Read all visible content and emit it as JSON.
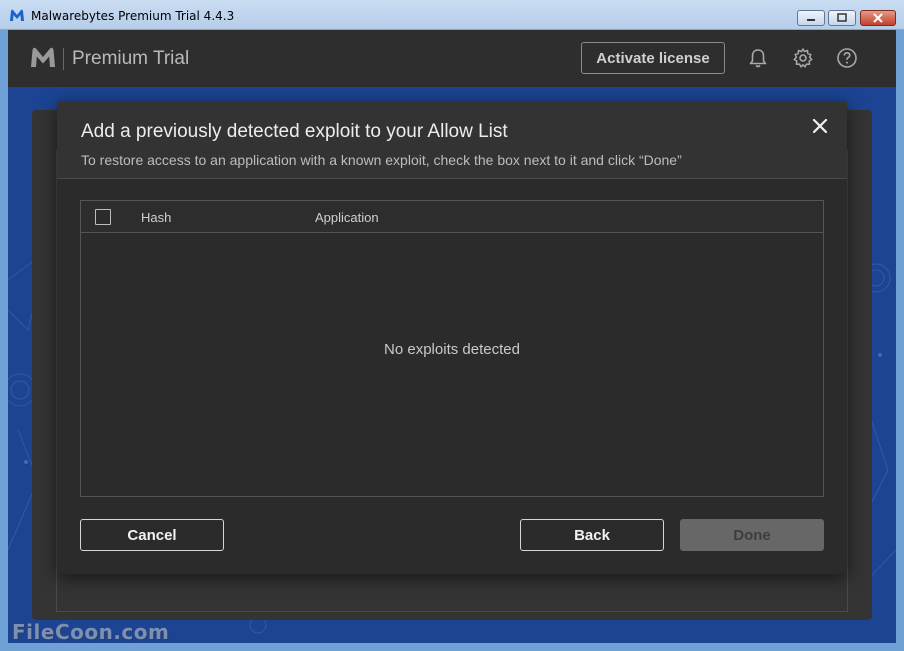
{
  "window": {
    "title": "Malwarebytes Premium Trial  4.4.3"
  },
  "header": {
    "brand": "Premium Trial",
    "activate_label": "Activate license",
    "icons": [
      "bell-icon",
      "gear-icon",
      "help-icon"
    ]
  },
  "dialog": {
    "title": "Add a previously detected exploit to your Allow List",
    "subtitle": "To restore access to an application with a known exploit, check the box next to it and click “Done”",
    "columns": [
      "Hash",
      "Application"
    ],
    "empty_message": "No exploits detected",
    "buttons": {
      "cancel": "Cancel",
      "back": "Back",
      "done": "Done"
    }
  },
  "watermark": "FileCoon.com",
  "colors": {
    "header_bg": "#2e2e2e",
    "dialog_bg": "#2b2b2b",
    "background_blue": "#1c4493",
    "done_disabled": "#676767"
  }
}
